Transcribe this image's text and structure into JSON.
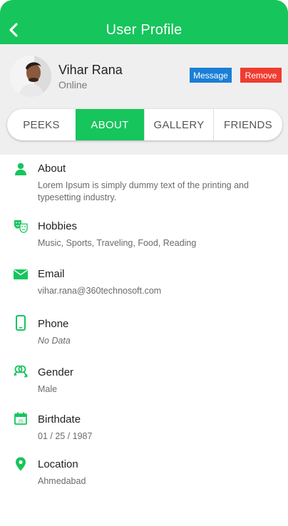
{
  "header": {
    "title": "User Profile",
    "accent": "#16c55c"
  },
  "profile": {
    "name": "Vihar Rana",
    "status": "Online",
    "message_label": "Message",
    "remove_label": "Remove"
  },
  "tabs": [
    {
      "label": "PEEKS",
      "active": false
    },
    {
      "label": "ABOUT",
      "active": true
    },
    {
      "label": "GALLERY",
      "active": false
    },
    {
      "label": "FRIENDS",
      "active": false
    }
  ],
  "about": [
    {
      "icon": "person-icon",
      "title": "About",
      "value": "Lorem Ipsum is simply dummy text of the printing and typesetting industry."
    },
    {
      "icon": "theater-masks-icon",
      "title": "Hobbies",
      "value": "Music, Sports, Traveling, Food, Reading"
    },
    {
      "icon": "envelope-icon",
      "title": "Email",
      "value": "vihar.rana@360technosoft.com"
    },
    {
      "icon": "phone-icon",
      "title": "Phone",
      "value": "No Data"
    },
    {
      "icon": "gender-icon",
      "title": "Gender",
      "value": "Male"
    },
    {
      "icon": "calendar-icon",
      "title": "Birthdate",
      "value": "01 / 25 / 1987",
      "calendar_day": "25"
    },
    {
      "icon": "location-pin-icon",
      "title": "Location",
      "value": "Ahmedabad"
    }
  ]
}
